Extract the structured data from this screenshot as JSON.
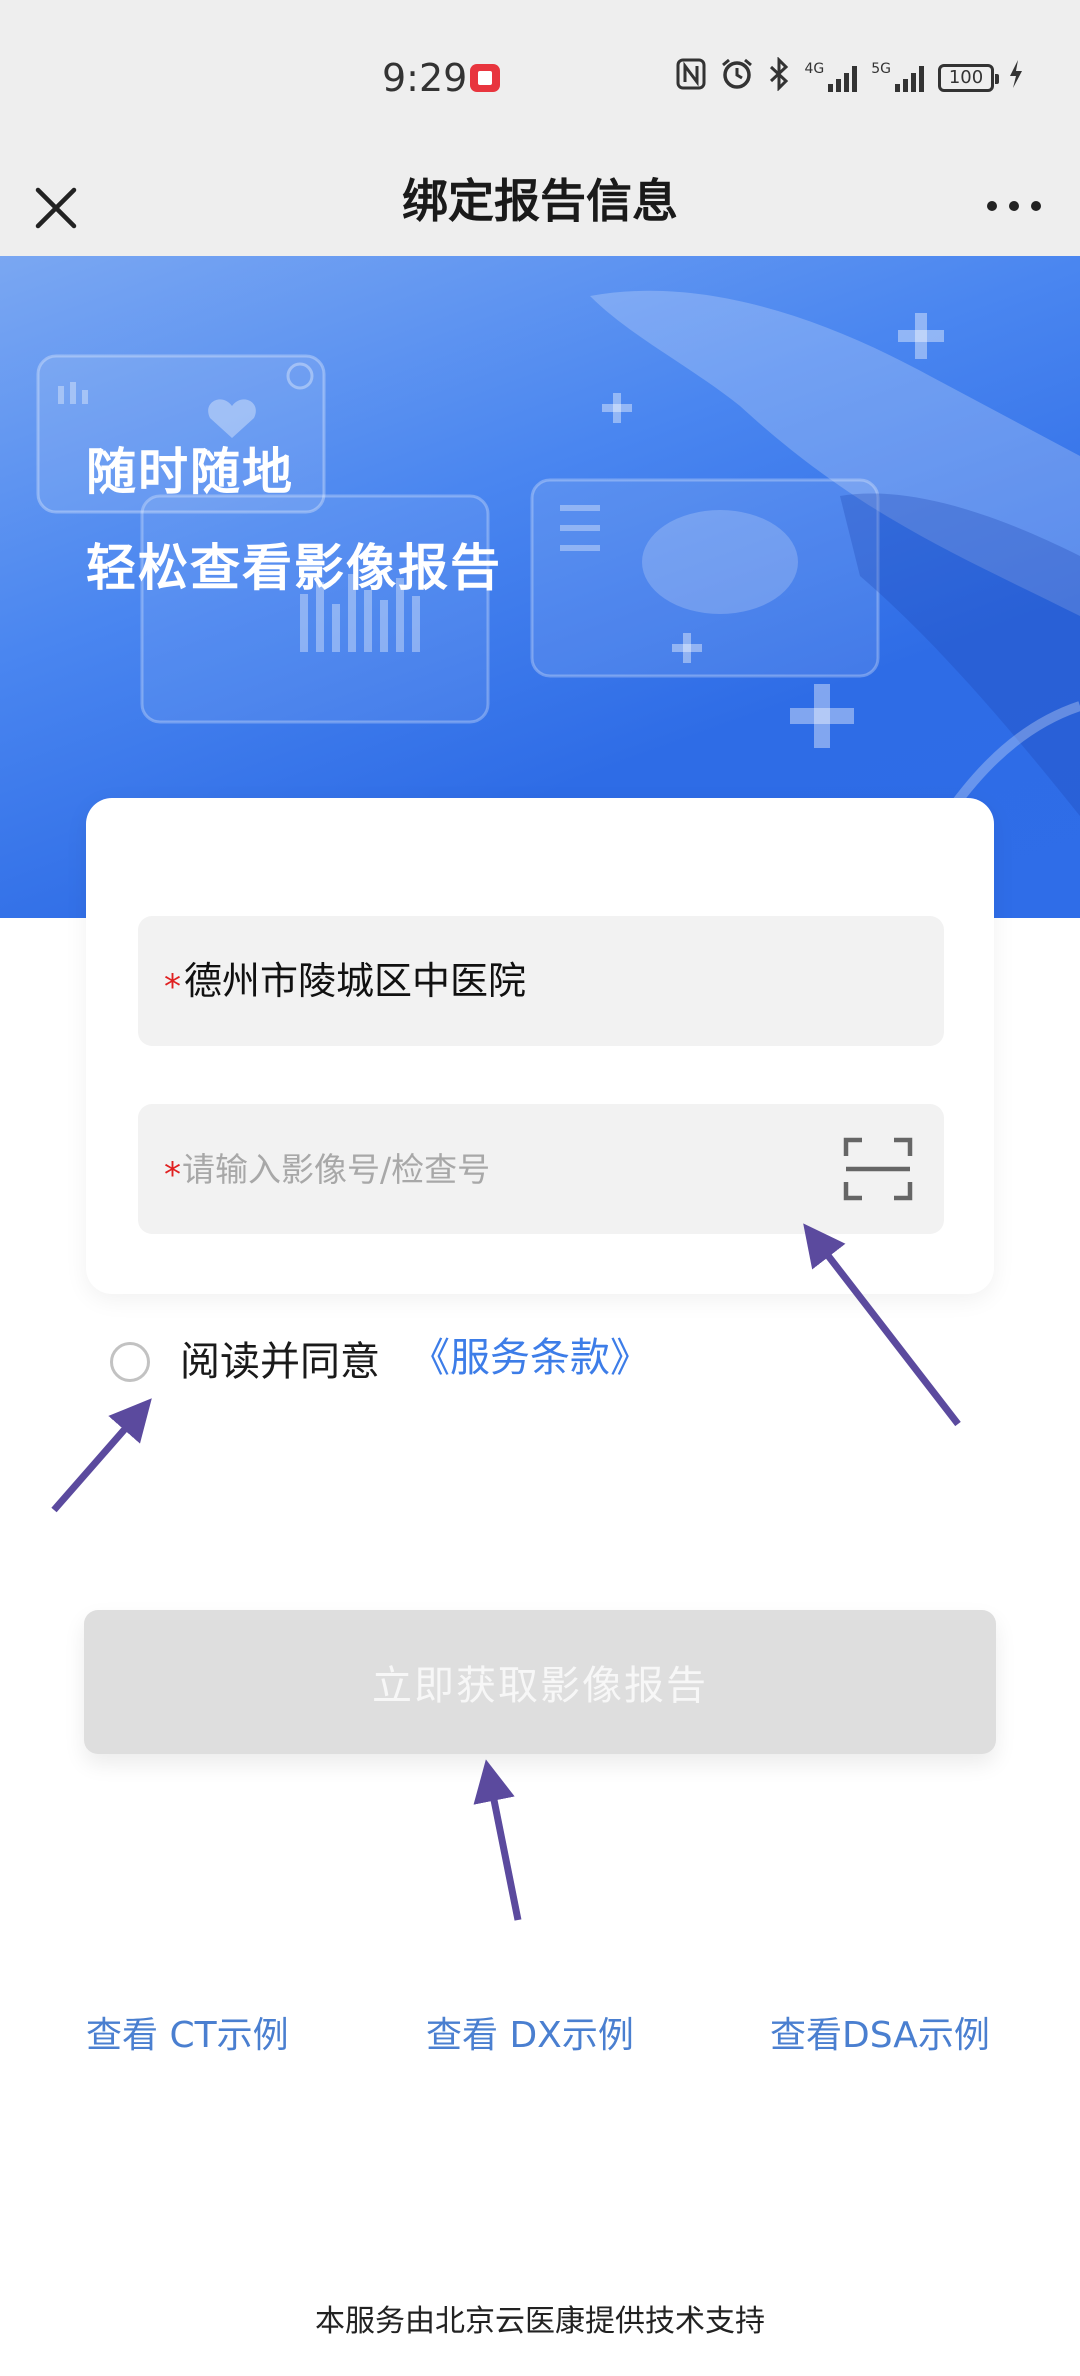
{
  "status_bar": {
    "time": "9:29",
    "battery": "100",
    "net_left": "4G",
    "net_right": "5G",
    "icons": [
      "nfc-icon",
      "alarm-icon",
      "bluetooth-icon",
      "signal-icon",
      "signal-icon",
      "battery-icon",
      "charging-icon"
    ]
  },
  "nav": {
    "title": "绑定报告信息",
    "close_icon": "close-icon",
    "more_icon": "more-dots-icon"
  },
  "banner": {
    "line1": "随时随地",
    "line2": "轻松查看影像报告",
    "gradient": [
      "#7aa7f2",
      "#2f6de8"
    ]
  },
  "form": {
    "hospital_value": "德州市陵城区中医院",
    "exam_placeholder": "请输入影像号/检查号",
    "exam_value": "",
    "required_mark": "*",
    "scan_icon": "scan-icon"
  },
  "agreement": {
    "text": "阅读并同意",
    "link": "《服务条款》",
    "checked": false
  },
  "submit": {
    "label": "立即获取影像报告",
    "enabled": false
  },
  "examples": {
    "ct": "查看 CT示例",
    "dx": "查看 DX示例",
    "dsa": "查看DSA示例"
  },
  "footer": {
    "text": "本服务由北京云医康提供技术支持"
  },
  "colors": {
    "accent": "#3d7de8",
    "link": "#4a7fd0",
    "required": "#e02020",
    "disabled_button": "#dedede",
    "annotation_arrow": "#5b4a9e"
  }
}
